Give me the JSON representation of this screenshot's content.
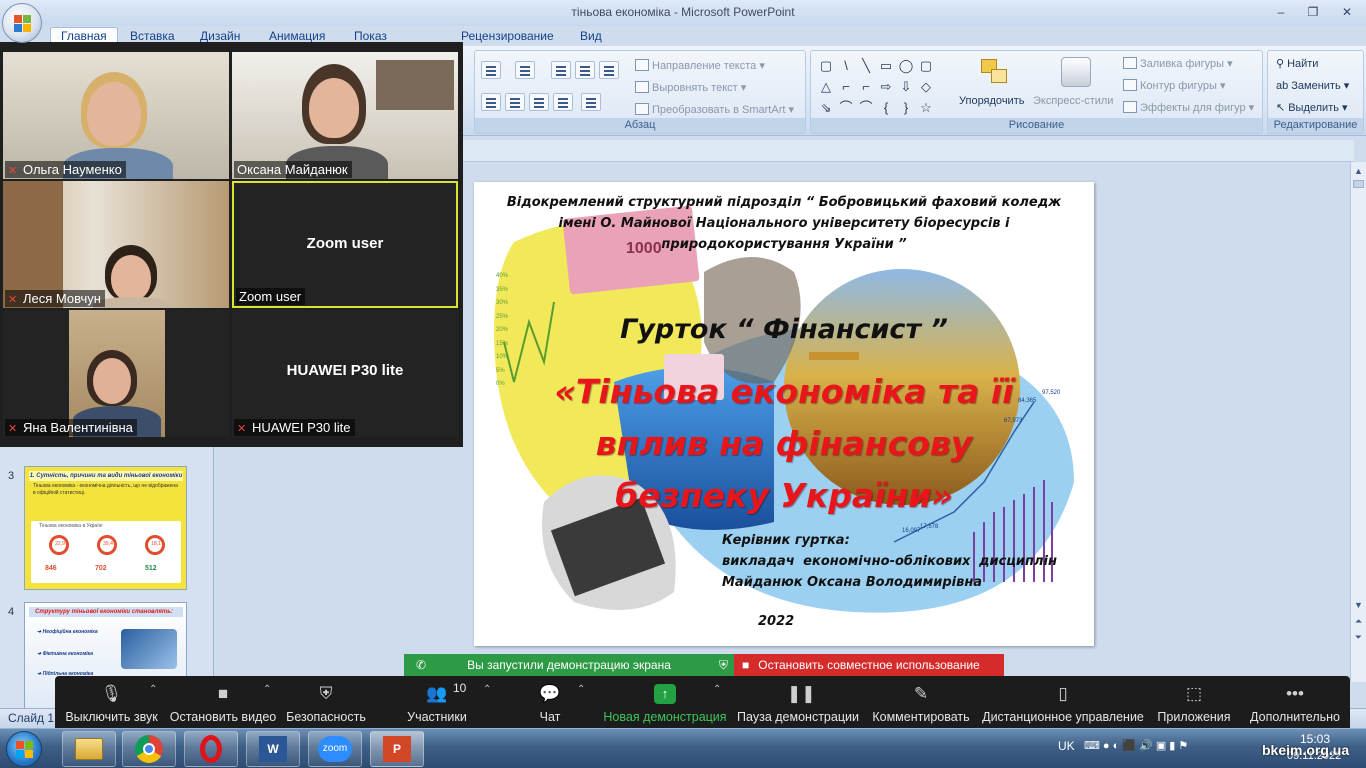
{
  "window": {
    "title": "тіньова економіка - Microsoft PowerPoint",
    "controls": {
      "minimize": "–",
      "maximize": "❐",
      "close": "✕"
    }
  },
  "ribbon_tabs": [
    "Главная",
    "Вставка",
    "Дизайн",
    "Анимация",
    "Показ слайдов",
    "Рецензирование",
    "Вид"
  ],
  "ribbon": {
    "paragraph": {
      "text_direction": "Направление текста",
      "align_text": "Выровнять текст",
      "smartart": "Преобразовать в SmartArt",
      "title": "Абзац"
    },
    "drawing": {
      "arrange": "Упорядочить",
      "quick_styles": "Экспресс-стили",
      "shape_fill": "Заливка фигуры",
      "shape_outline": "Контур фигуры",
      "shape_effects": "Эффекты для фигур",
      "title": "Рисование",
      "shapes": [
        "▢",
        "\\",
        "╲",
        "▭",
        "◯",
        "▢",
        "△",
        "⌐",
        "⌐",
        "⇨",
        "⇩",
        "◇",
        "⇘",
        "⌒",
        "⌒",
        "{",
        "}",
        "☆"
      ]
    },
    "editing": {
      "find": "Найти",
      "replace": "Заменить",
      "select": "Выделить",
      "title": "Редактирование"
    }
  },
  "slide_pane": {
    "thumbs": [
      {
        "number": "3",
        "heading": "1. Сутність, причини та види тіньової економіки",
        "body": "Тіньова економіка - економічна діяльність, що не відображена в офіційній статистиці.",
        "stats": [
          "22,9",
          "39,4",
          "18,1"
        ],
        "values": [
          "846",
          "702",
          "512"
        ],
        "chart_caption": "Тіньова економіка в Україні"
      },
      {
        "number": "4",
        "heading": "Структуру тіньової економіки становлять:",
        "items": [
          "Неофіційна економіка",
          "Фіктивна економіка",
          "Підпільна економіка"
        ]
      }
    ],
    "status": "Слайд 1"
  },
  "slide": {
    "institution": "Відокремлений структурний підрозділ “ Бобровицький фаховий коледж імені О. Майнової Національного університету біоресурсів і природокористування України ”",
    "club": "Гурток “ Фінансист ”",
    "topic": "«Тіньова економіка та її вплив на фінансову безпеку України»",
    "leader_title": "Керівник гуртка:",
    "leader_position": "викладач економічно-облікових дисциплін",
    "leader_name": "Майданюк Оксана Володимирівна",
    "year": "2022",
    "chart_values": [
      "97,520",
      "84,365",
      "67,973",
      "16,097",
      "17,578"
    ],
    "axis_ticks": [
      "40%",
      "35%",
      "30%",
      "25%",
      "20%",
      "15%",
      "10%",
      "5%",
      "0%"
    ],
    "banknote_label": "1000"
  },
  "participants": [
    {
      "name": "Ольга Науменко",
      "muted": true
    },
    {
      "name": "Оксана Майданюк",
      "muted": false
    },
    {
      "name": "Леся Мовчун",
      "muted": true
    },
    {
      "name": "Zoom user",
      "center": "Zoom user",
      "muted": false,
      "active": true
    },
    {
      "name": "Яна Валентинівна",
      "muted": true
    },
    {
      "name": "HUAWEI P30 lite",
      "center": "HUAWEI P30 lite",
      "muted": true
    }
  ],
  "share": {
    "status": "Вы запустили демонстрацию экрана",
    "stop": "Остановить совместное использование"
  },
  "zoom_toolbar": {
    "mute": "Выключить звук",
    "stop_video": "Остановить видео",
    "security": "Безопасность",
    "participants": "Участники",
    "participants_count": "10",
    "chat": "Чат",
    "new_share": "Новая демонстрация",
    "pause_share": "Пауза демонстрации",
    "annotate": "Комментировать",
    "remote_control": "Дистанционное управление",
    "apps": "Приложения",
    "more": "Дополнительно"
  },
  "taskbar": {
    "language": "UK",
    "time": "15:03",
    "date": "09.11.2022",
    "watermark": "bkeim.org.ua"
  },
  "colors": {
    "accent_green": "#2d9b45",
    "accent_red": "#d52b2b",
    "slide_title_red": "#e8161b",
    "slide_blue": "#1a5ea8"
  }
}
